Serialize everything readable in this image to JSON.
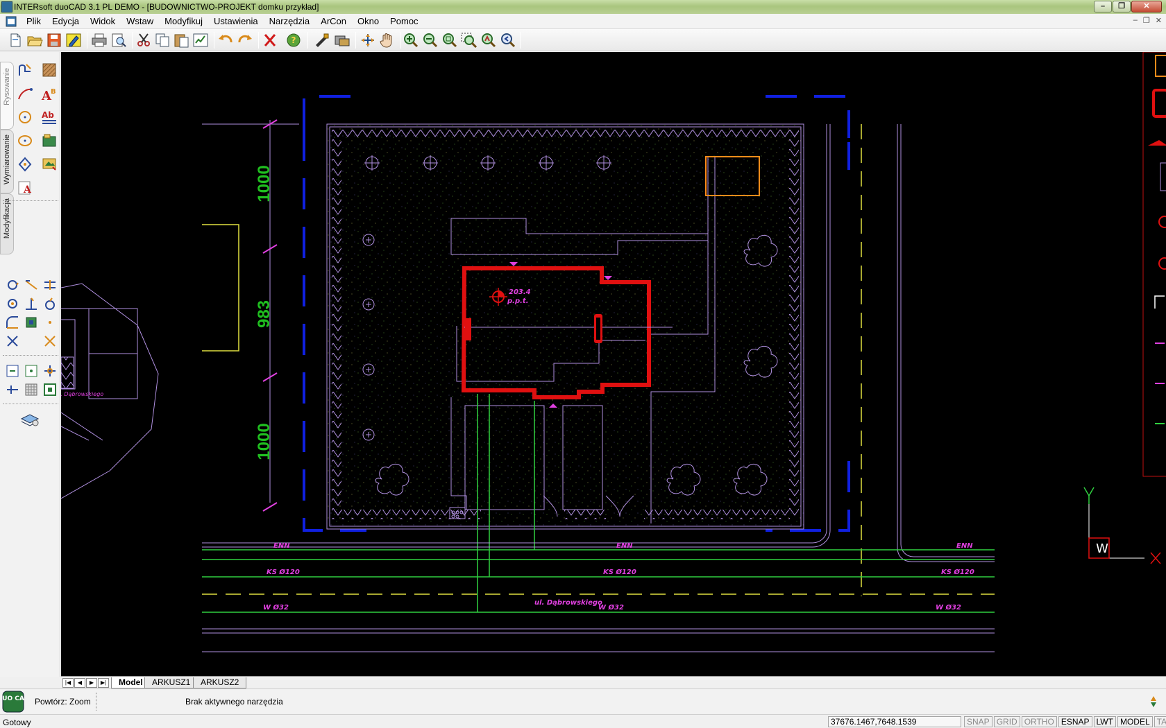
{
  "window": {
    "title": "INTERsoft duoCAD 3.1 PL DEMO - [BUDOWNICTWO-PROJEKT domku przykład]",
    "minimize_glyph": "–",
    "maximize_glyph": "❐",
    "close_glyph": "✕"
  },
  "menu": {
    "items": [
      "Plik",
      "Edycja",
      "Widok",
      "Wstaw",
      "Modyfikuj",
      "Ustawienia",
      "Narzędzia",
      "ArCon",
      "Okno",
      "Pomoc"
    ],
    "doc_buttons": [
      "–",
      "❐",
      "✕"
    ]
  },
  "toolbar": {
    "icons": [
      "new-file-icon",
      "open-folder-icon",
      "save-icon",
      "edit-icon",
      "print-icon",
      "print-preview-icon",
      "cut-icon",
      "copy-icon",
      "paste-icon",
      "properties-icon",
      "undo-icon",
      "redo-icon",
      "delete-icon",
      "help-icon",
      "match-properties-icon",
      "layers-icon",
      "pan-realtime-icon",
      "hand-pan-icon",
      "zoom-in-icon",
      "zoom-out-icon",
      "zoom-extents-icon",
      "zoom-window-icon",
      "zoom-all-icon",
      "zoom-previous-icon"
    ]
  },
  "left_panel": {
    "tabs": [
      "Rysowanie",
      "Wymiarowanie",
      "Modyfikacja"
    ],
    "active_tab": "Rysowanie"
  },
  "drawing": {
    "dimensions": [
      "1000",
      "983",
      "1000"
    ],
    "level_value": "203.4",
    "level_label": "p.p.t.",
    "utility_labels": {
      "enn_left": "ENN",
      "enn_mid": "ENN",
      "enn_right": "ENN",
      "ks_left": "KS Ø120",
      "ks_mid": "KS Ø120",
      "ks_right": "KS Ø120",
      "w_left": "W Ø32",
      "w_mid": "W Ø32",
      "w_right": "W Ø32",
      "street": "ul. Dąbrowskiego",
      "left_small": "ul. Dąbrowskiego"
    },
    "ucs": {
      "y": "Y",
      "x": "X",
      "w": "W"
    },
    "colors": {
      "dimension": "#20c020",
      "house_wall": "#e01010",
      "outline": "#b090e0",
      "blue_frame": "#1020e0",
      "yellow_axis": "#e0e040",
      "utility_green": "#30d040",
      "label_magenta": "#e040e0",
      "orange_box": "#ff8c1a"
    }
  },
  "sheet_tabs": {
    "nav": [
      "|◀",
      "◀",
      "▶",
      "▶|"
    ],
    "tabs": [
      "Model",
      "ARKUSZ1",
      "ARKUSZ2"
    ],
    "active": "Model"
  },
  "command": {
    "logo": "DUO CAD",
    "repeat": "Powtórz: Zoom",
    "message": "Brak aktywnego narzędzia"
  },
  "status": {
    "text": "Gotowy",
    "coordinates": "37676.1467,7648.1539",
    "toggles": [
      {
        "label": "SNAP",
        "on": false
      },
      {
        "label": "GRID",
        "on": false
      },
      {
        "label": "ORTHO",
        "on": false
      },
      {
        "label": "ESNAP",
        "on": true
      },
      {
        "label": "LWT",
        "on": true
      },
      {
        "label": "MODEL",
        "on": true
      },
      {
        "label": "TABLET",
        "on": false
      }
    ]
  }
}
